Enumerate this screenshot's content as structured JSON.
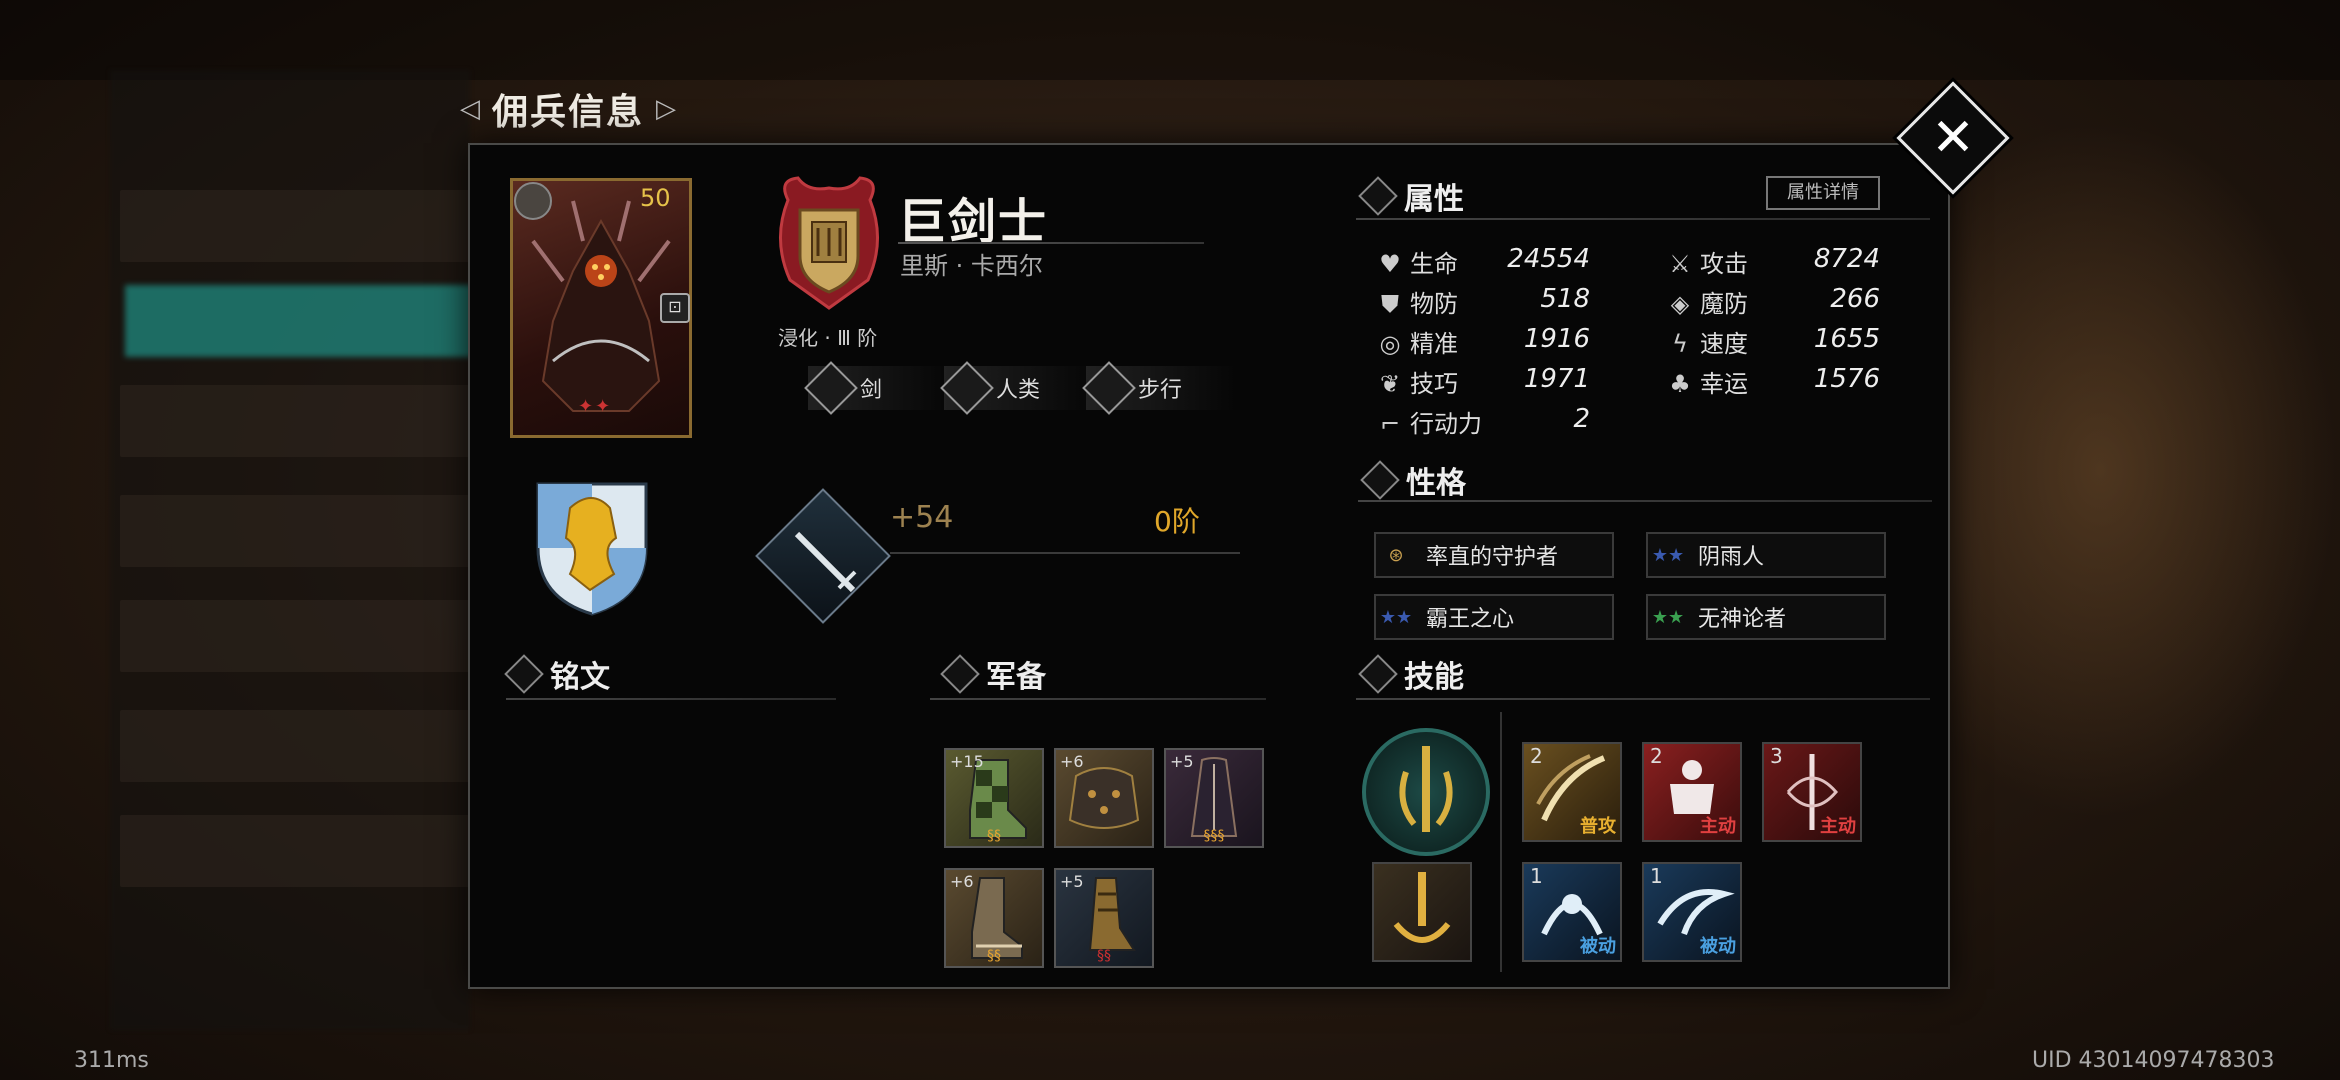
{
  "window": {
    "title": "佣兵信息"
  },
  "close_icon": "close-x-icon",
  "card": {
    "level": "50",
    "icon": "sword-icon",
    "lock_icon": "lock-icon",
    "stars": "✦✦"
  },
  "hero": {
    "name": "巨剑士",
    "subtitle": "里斯 · 卡西尔",
    "rank": "浸化 · Ⅲ 阶",
    "tags": [
      {
        "label": "剑",
        "icon": "sword-icon"
      },
      {
        "label": "人类",
        "icon": "helmet-icon"
      },
      {
        "label": "步行",
        "icon": "boot-icon"
      }
    ]
  },
  "weapon": {
    "plus": "+54",
    "tier": "0阶",
    "icon": "sword-icon"
  },
  "attributes": {
    "title": "属性",
    "detail_button": "属性详情",
    "left": [
      {
        "label": "生命",
        "value": "24554",
        "icon": "heart-icon"
      },
      {
        "label": "物防",
        "value": "518",
        "icon": "shield-icon"
      },
      {
        "label": "精准",
        "value": "1916",
        "icon": "target-icon"
      },
      {
        "label": "技巧",
        "value": "1971",
        "icon": "feather-icon"
      },
      {
        "label": "行动力",
        "value": "2",
        "icon": "boot-icon"
      }
    ],
    "right": [
      {
        "label": "攻击",
        "value": "8724",
        "icon": "crossed-swords-icon"
      },
      {
        "label": "魔防",
        "value": "266",
        "icon": "magic-shield-icon"
      },
      {
        "label": "速度",
        "value": "1655",
        "icon": "lightning-icon"
      },
      {
        "label": "幸运",
        "value": "1576",
        "icon": "clover-icon"
      }
    ]
  },
  "personality": {
    "title": "性格",
    "traits": [
      {
        "label": "率直的守护者",
        "icon": "rings-icon",
        "color": "#c9a050"
      },
      {
        "label": "阴雨人",
        "icon": "stars-icon",
        "color": "#3a5ab0"
      },
      {
        "label": "霸王之心",
        "icon": "stars-icon",
        "color": "#3a5ab0"
      },
      {
        "label": "无神论者",
        "icon": "stars-icon",
        "color": "#3aa050"
      }
    ]
  },
  "inscription": {
    "title": "铭文"
  },
  "equipment": {
    "title": "军备",
    "items": [
      {
        "plus": "+15",
        "stars": "§§",
        "icon": "checkered-boot-icon"
      },
      {
        "plus": "+6",
        "stars": "",
        "icon": "armor-icon"
      },
      {
        "plus": "+5",
        "stars": "§§§",
        "icon": "cloak-icon"
      },
      {
        "plus": "+6",
        "stars": "§§",
        "icon": "boot-icon"
      },
      {
        "plus": "+5",
        "stars": "§§",
        "icon": "greave-icon"
      }
    ]
  },
  "skills": {
    "title": "技能",
    "items": [
      {
        "count": "2",
        "type": "普攻",
        "type_color": "#e8b030",
        "icon": "slash-icon"
      },
      {
        "count": "2",
        "type": "主动",
        "type_color": "#e04040",
        "icon": "giant-icon"
      },
      {
        "count": "3",
        "type": "主动",
        "type_color": "#e04040",
        "icon": "sword-swirl-icon"
      },
      {
        "count": "1",
        "type": "被动",
        "type_color": "#4aa0e0",
        "icon": "serpent-icon"
      },
      {
        "count": "1",
        "type": "被动",
        "type_color": "#4aa0e0",
        "icon": "wave-icon"
      }
    ]
  },
  "footer": {
    "latency": "311ms",
    "uid": "UID 43014097478303"
  }
}
